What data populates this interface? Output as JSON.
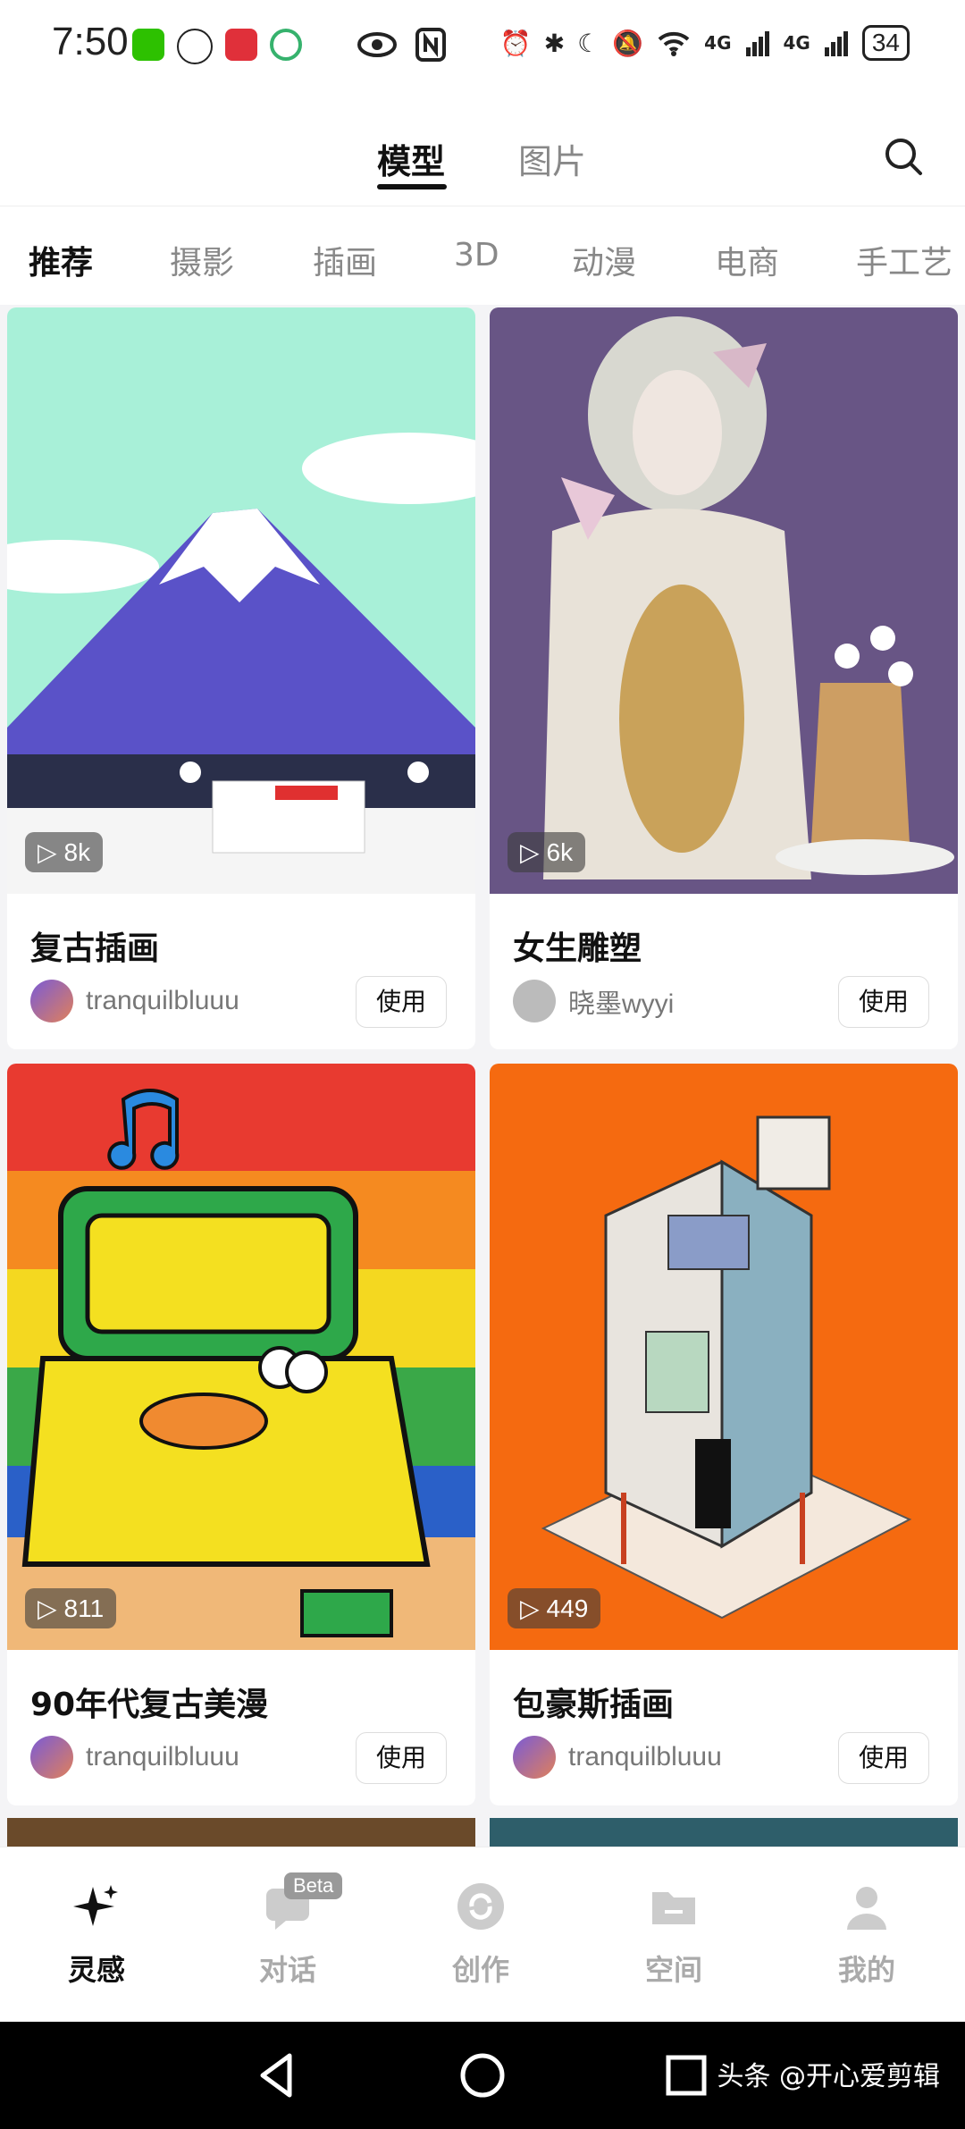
{
  "status_bar": {
    "time": "7:50",
    "signal_1": "4G",
    "signal_2": "4G",
    "battery": "34"
  },
  "header": {
    "tabs": [
      {
        "label": "模型",
        "active": true
      },
      {
        "label": "图片",
        "active": false
      }
    ]
  },
  "categories": [
    "推荐",
    "摄影",
    "插画",
    "3D",
    "动漫",
    "电商",
    "手工艺"
  ],
  "cards": [
    {
      "title": "复古插画",
      "plays": "8k",
      "author": "tranquilbluuu",
      "use_label": "使用"
    },
    {
      "title": "女生雕塑",
      "plays": "6k",
      "author": "晓墨wyyi",
      "use_label": "使用"
    },
    {
      "title": "90年代复古美漫",
      "plays": "811",
      "author": "tranquilbluuu",
      "use_label": "使用"
    },
    {
      "title": "包豪斯插画",
      "plays": "449",
      "author": "tranquilbluuu",
      "use_label": "使用"
    }
  ],
  "bottom_nav": {
    "items": [
      {
        "label": "灵感",
        "icon": "sparkle-icon",
        "active": true
      },
      {
        "label": "对话",
        "icon": "chat-icon",
        "active": false
      },
      {
        "label": "创作",
        "icon": "create-icon",
        "active": false
      },
      {
        "label": "空间",
        "icon": "folder-icon",
        "active": false
      },
      {
        "label": "我的",
        "icon": "profile-icon",
        "active": false
      }
    ],
    "beta_badge": "Beta"
  },
  "watermark": "头条 @开心爱剪辑",
  "colors": {
    "accent": "#111111",
    "inactive": "#aaaaaa",
    "background": "#f4f4f6"
  }
}
